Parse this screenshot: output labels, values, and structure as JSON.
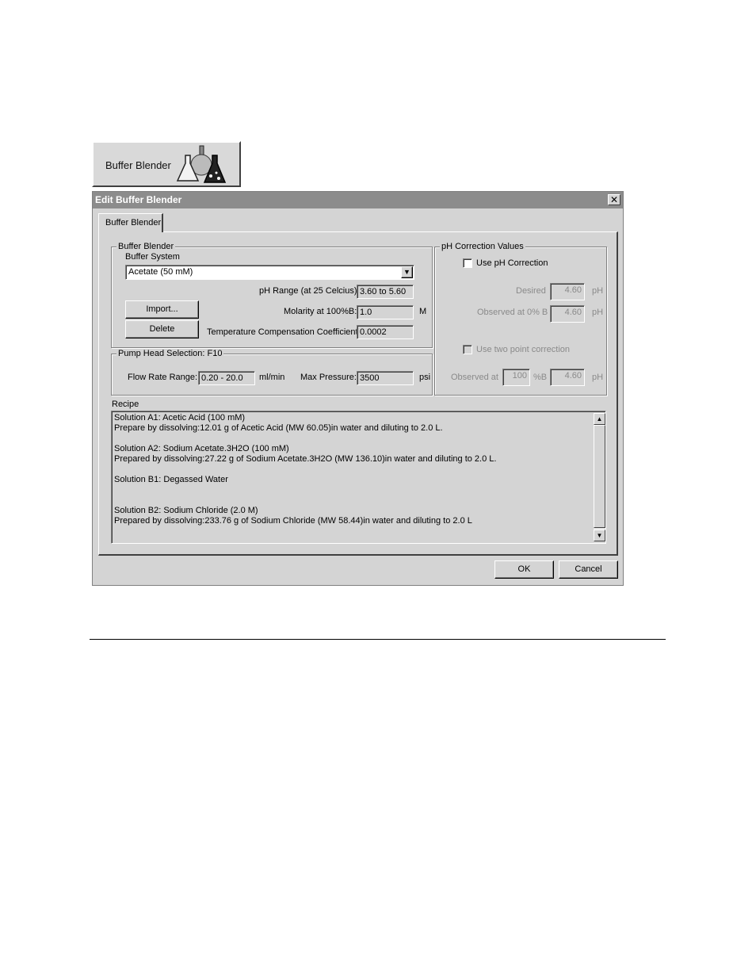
{
  "launcher": {
    "label": "Buffer Blender",
    "icon": "flask-icon"
  },
  "dialog": {
    "title": "Edit Buffer Blender",
    "tab": "Buffer Blender",
    "buffer_group": {
      "title": "Buffer Blender",
      "system_label": "Buffer System",
      "system_value": "Acetate (50 mM)",
      "ph_range_label": "pH Range (at 25 Celcius)",
      "ph_range_value": "3.60 to 5.60",
      "molarity_label": "Molarity at 100%B:",
      "molarity_value": "1.0",
      "molarity_unit": "M",
      "tcc_label": "Temperature Compensation Coefficient:",
      "tcc_value": "0.0002",
      "import_label": "Import...",
      "delete_label": "Delete"
    },
    "pump_group": {
      "title": "Pump Head Selection:  F10",
      "flow_label": "Flow Rate Range:",
      "flow_value": "0.20 - 20.0",
      "flow_unit": "ml/min",
      "pressure_label": "Max Pressure:",
      "pressure_value": "3500",
      "pressure_unit": "psi"
    },
    "ph_group": {
      "title": "pH Correction Values",
      "use_label": "Use pH Correction",
      "desired_label": "Desired",
      "desired_value": "4.60",
      "obs0_label": "Observed at 0% B",
      "obs0_value": "4.60",
      "ph_unit": "pH",
      "two_point_label": "Use two point correction",
      "obs_at_label": "Observed at",
      "obs_at_value": "100",
      "obs_at_unit": "%B",
      "obs_at_ph": "4.60"
    },
    "recipe": {
      "label": "Recipe",
      "lines": [
        "Solution A1:  Acetic Acid  (100 mM)",
        "Prepare by dissolving:12.01 g of Acetic Acid (MW 60.05)in water  and diluting to 2.0 L.",
        "Solution A2:  Sodium Acetate.3H2O  (100 mM)",
        "Prepared by dissolving:27.22 g of Sodium Acetate.3H2O (MW 136.10)in water and diluting to 2.0 L.",
        "Solution B1:  Degassed Water",
        "Solution B2:  Sodium Chloride (2.0 M)",
        "Prepared by dissolving:233.76 g of Sodium Chloride (MW 58.44)in water and diluting to 2.0 L"
      ]
    },
    "ok_label": "OK",
    "cancel_label": "Cancel"
  }
}
